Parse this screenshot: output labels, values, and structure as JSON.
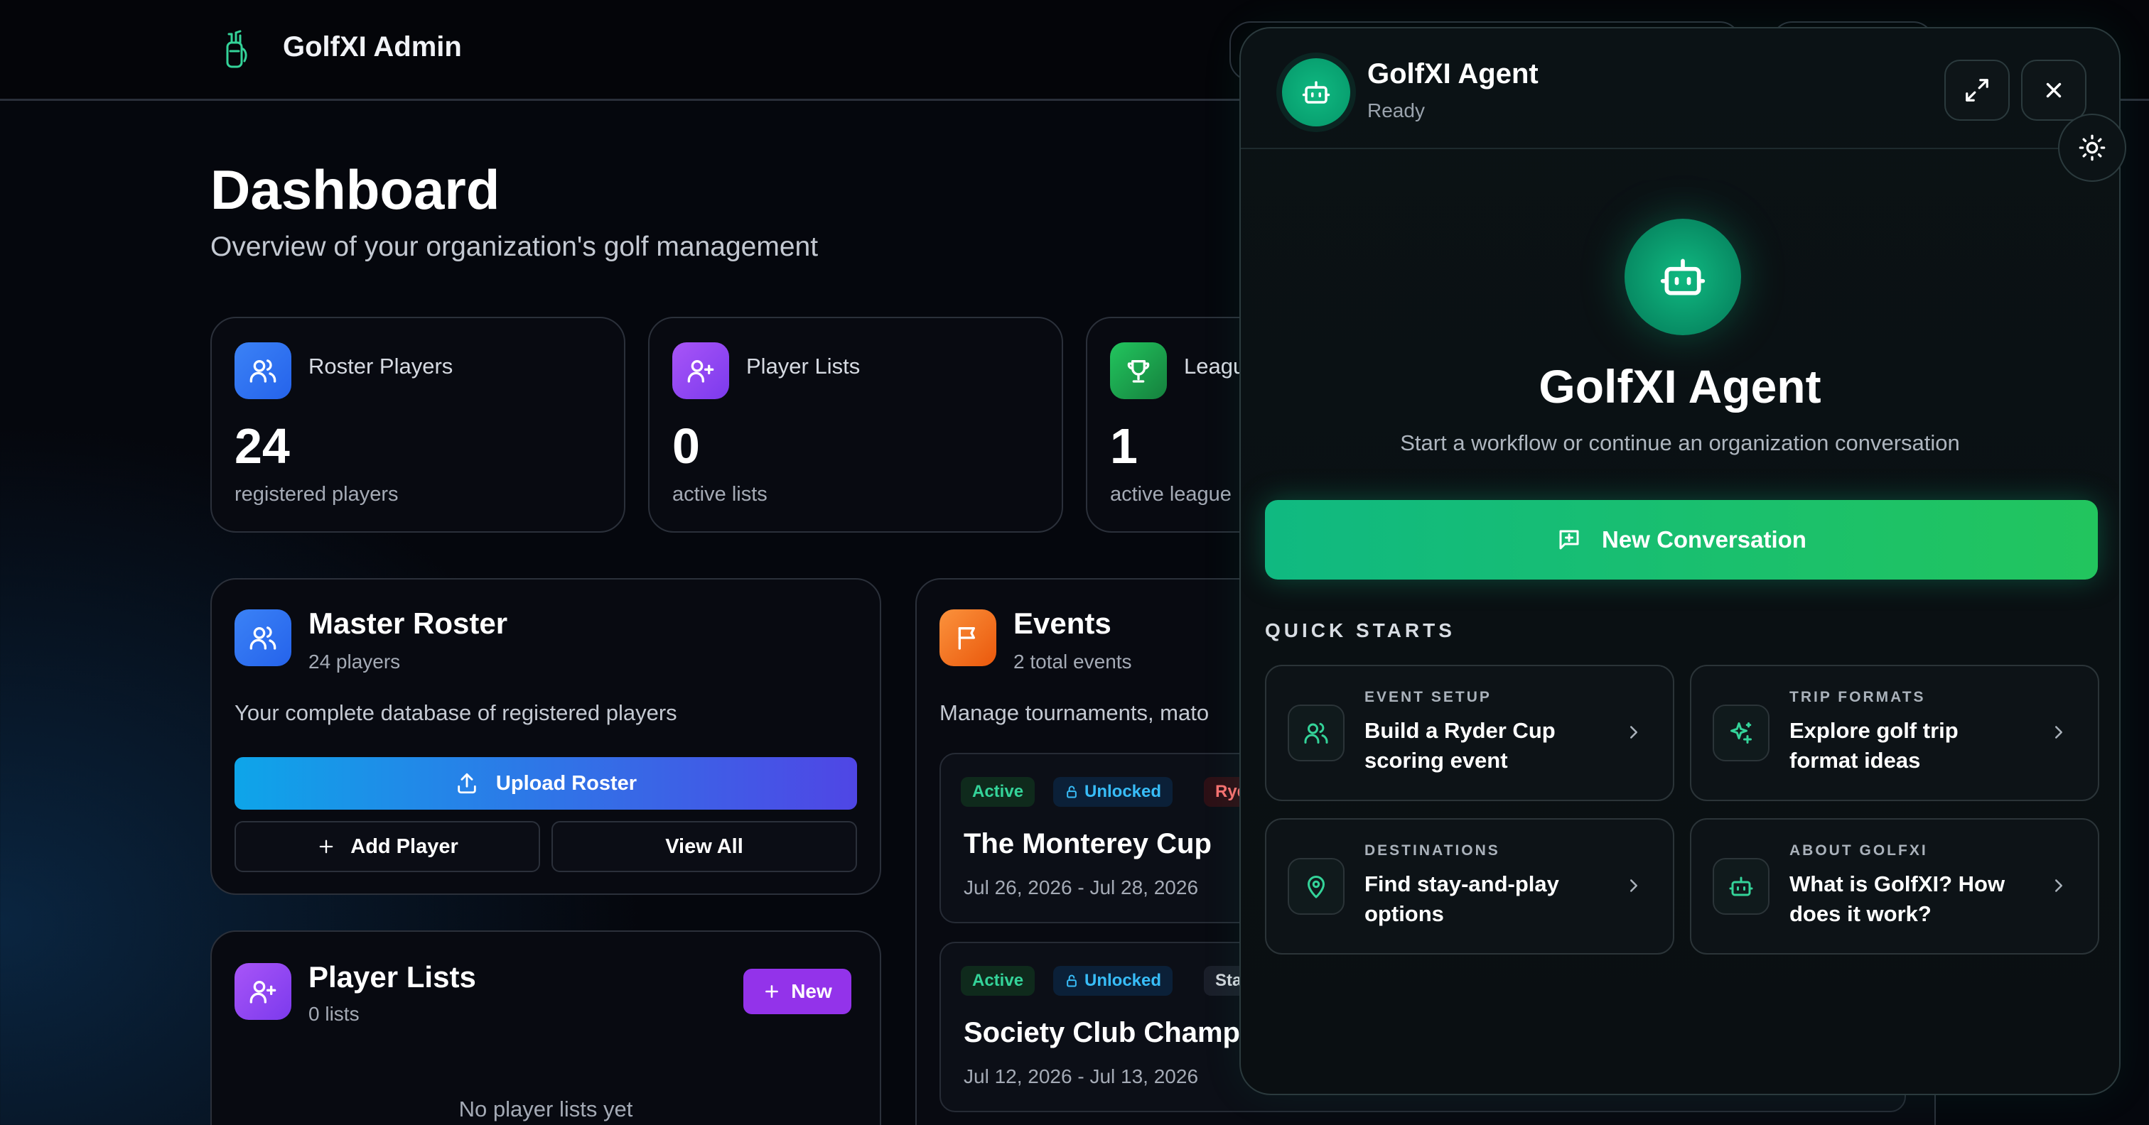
{
  "header": {
    "brand": "GolfXI Admin"
  },
  "page": {
    "title": "Dashboard",
    "subtitle": "Overview of your organization's golf management"
  },
  "stats": [
    {
      "label": "Roster Players",
      "value": "24",
      "sub": "registered players",
      "icon": "users-icon"
    },
    {
      "label": "Player Lists",
      "value": "0",
      "sub": "active lists",
      "icon": "user-plus-icon"
    },
    {
      "label": "Leagu",
      "value": "1",
      "sub": "active league",
      "icon": "trophy-icon"
    }
  ],
  "master_roster": {
    "title": "Master Roster",
    "count": "24 players",
    "description": "Your complete database of registered players",
    "upload_label": "Upload Roster",
    "add_label": "Add Player",
    "view_label": "View All"
  },
  "player_lists": {
    "title": "Player Lists",
    "count": "0 lists",
    "new_label": "New",
    "empty": "No player lists yet"
  },
  "events": {
    "title": "Events",
    "count": "2 total events",
    "description": "Manage tournaments, mato",
    "items": [
      {
        "tags": [
          "Active",
          "Unlocked",
          "Ryde"
        ],
        "name": "The Monterey Cup",
        "dates": "Jul 26, 2026 - Jul 28, 2026"
      },
      {
        "tags": [
          "Active",
          "Unlocked",
          "Stan"
        ],
        "name": "Society Club Champi",
        "dates": "Jul 12, 2026 - Jul 13, 2026"
      }
    ]
  },
  "agent": {
    "name": "GolfXI Agent",
    "status": "Ready",
    "hero_title": "GolfXI Agent",
    "hero_sub": "Start a workflow or continue an organization conversation",
    "new_conversation": "New Conversation",
    "quick_starts_label": "QUICK STARTS",
    "quick_starts": [
      {
        "category": "EVENT SETUP",
        "text": "Build a Ryder Cup scoring event",
        "icon": "users-icon"
      },
      {
        "category": "TRIP FORMATS",
        "text": "Explore golf trip format ideas",
        "icon": "sparkles-icon"
      },
      {
        "category": "DESTINATIONS",
        "text": "Find stay-and-play options",
        "icon": "map-pin-icon"
      },
      {
        "category": "ABOUT GOLFXI",
        "text": "What is GolfXI? How does it work?",
        "icon": "bot-icon"
      }
    ]
  },
  "colors": {
    "accent_green": "#10b981",
    "accent_blue": "#3b82f6",
    "accent_purple": "#9333ea",
    "accent_orange": "#f97316"
  }
}
